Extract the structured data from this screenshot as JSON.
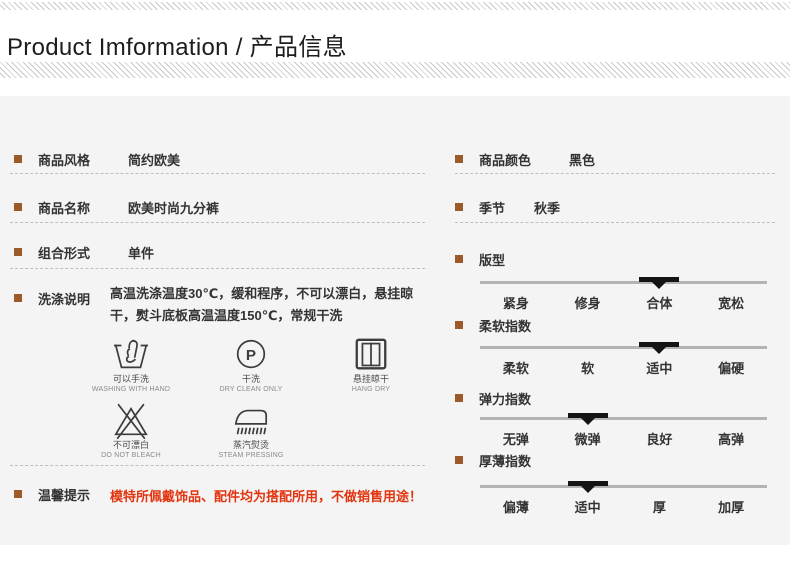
{
  "header": {
    "title": "Product Imformation / 产品信息"
  },
  "colors": {
    "accent_brown": "#9c5a28",
    "tip_red": "#e2340f",
    "panel_bg": "#f4f4f4",
    "slider_track": "#b3b3b3",
    "slider_marker": "#141414"
  },
  "left": {
    "rows": [
      {
        "label": "商品风格",
        "value": "简约欧美"
      },
      {
        "label": "商品名称",
        "value": "欧美时尚九分裤"
      },
      {
        "label": "组合形式",
        "value": "单件"
      }
    ],
    "washing": {
      "label": "洗涤说明",
      "text": "高温洗涤温度30℃，缓和程序，不可以漂白，悬挂晾干，熨斗底板高温温度150℃，常规干洗",
      "icons": [
        {
          "icon": "hand-wash-icon",
          "zh": "可以手洗",
          "en": "WASHING WITH HAND"
        },
        {
          "icon": "dry-clean-icon",
          "zh": "干洗",
          "en": "DRY CLEAN ONLY"
        },
        {
          "icon": "hang-dry-icon",
          "zh": "悬挂晾干",
          "en": "HANG DRY"
        },
        {
          "icon": "no-bleach-icon",
          "zh": "不可漂白",
          "en": "DO NOT BLEACH"
        },
        {
          "icon": "steam-press-icon",
          "zh": "蒸汽熨烫",
          "en": "STEAM PRESSING"
        }
      ],
      "dry_clean_letter": "P"
    },
    "tips": {
      "label": "温馨提示",
      "value": "模特所佩戴饰品、配件均为搭配所用，不做销售用途！"
    }
  },
  "right": {
    "rows": [
      {
        "label": "商品颜色",
        "value": "黑色"
      },
      {
        "label": "季节",
        "value": "秋季"
      }
    ],
    "sliders": [
      {
        "label": "版型",
        "options": [
          "紧身",
          "修身",
          "合体",
          "宽松"
        ],
        "selected": "合体",
        "selected_index": 2
      },
      {
        "label": "柔软指数",
        "options": [
          "柔软",
          "软",
          "适中",
          "偏硬"
        ],
        "selected": "适中",
        "selected_index": 2
      },
      {
        "label": "弹力指数",
        "options": [
          "无弹",
          "微弹",
          "良好",
          "高弹"
        ],
        "selected": "微弹",
        "selected_index": 1
      },
      {
        "label": "厚薄指数",
        "options": [
          "偏薄",
          "适中",
          "厚",
          "加厚"
        ],
        "selected": "适中",
        "selected_index": 1
      }
    ]
  }
}
